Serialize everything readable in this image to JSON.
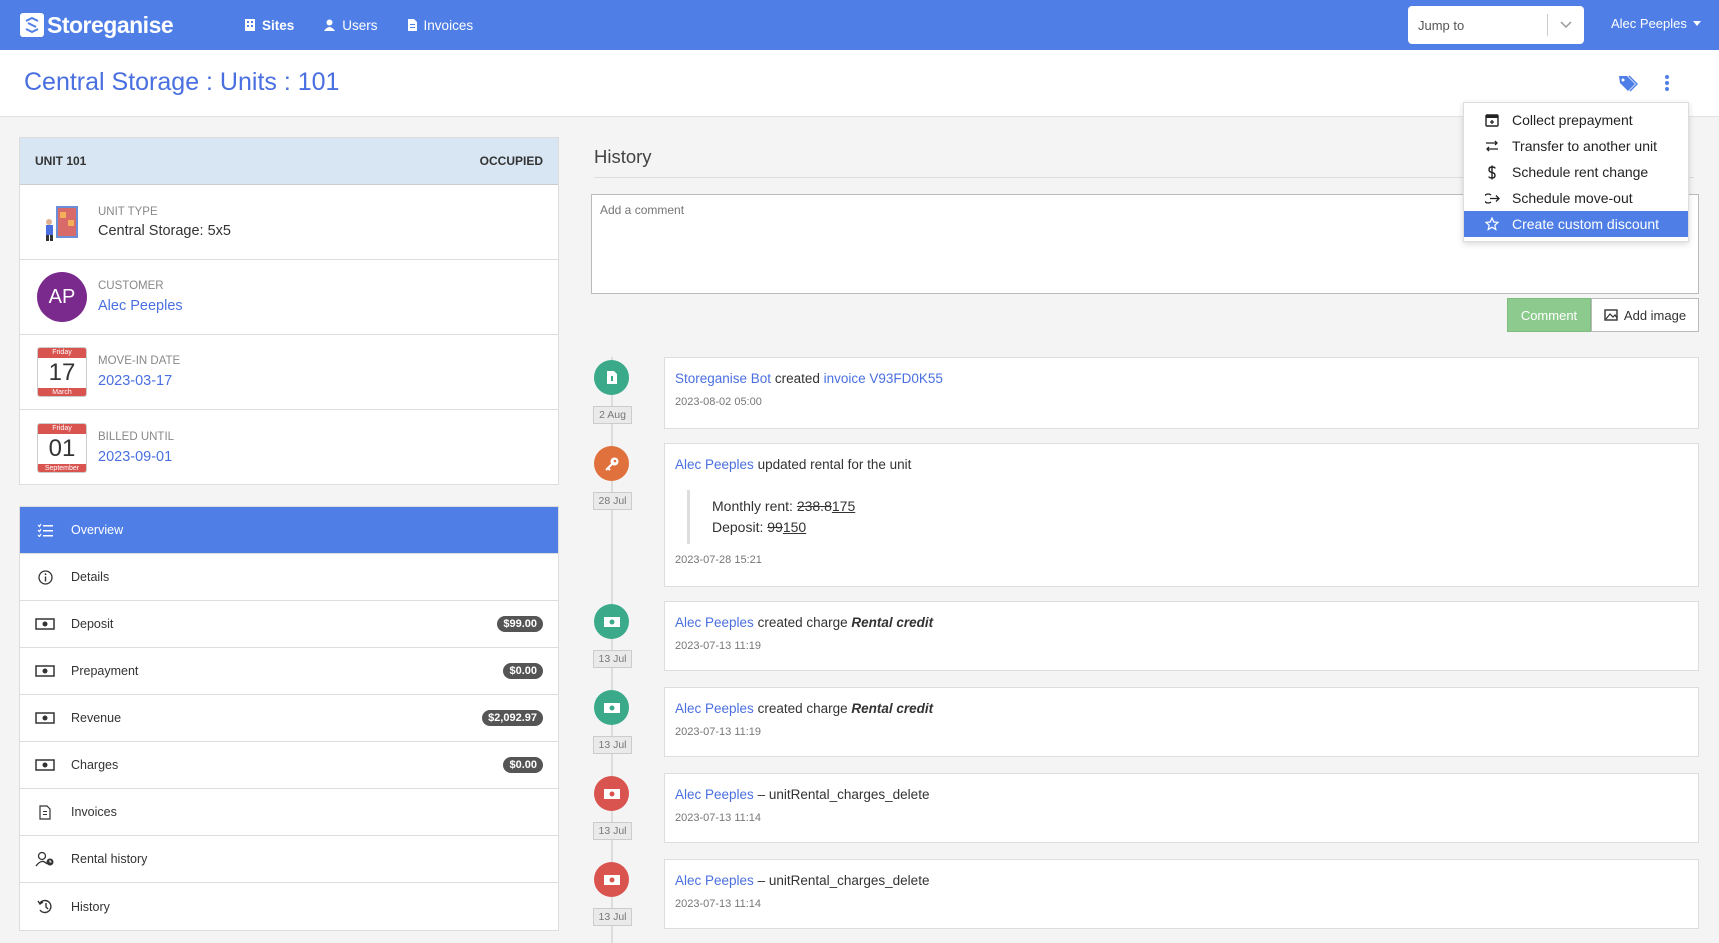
{
  "nav": {
    "brand": "Storeganise",
    "links": [
      {
        "label": "Sites",
        "icon": "building-icon"
      },
      {
        "label": "Users",
        "icon": "user-icon"
      },
      {
        "label": "Invoices",
        "icon": "invoice-icon"
      }
    ],
    "jump_placeholder": "Jump to",
    "user": "Alec Peeples"
  },
  "page": {
    "title": "Central Storage : Units : 101"
  },
  "unit": {
    "header_left": "UNIT 101",
    "header_right": "OCCUPIED",
    "type_label": "UNIT TYPE",
    "type_value": "Central Storage: 5x5",
    "customer_label": "CUSTOMER",
    "customer_initials": "AP",
    "customer_name": "Alec Peeples",
    "movein_label": "MOVE-IN DATE",
    "movein_value": "2023-03-17",
    "movein_cal": {
      "weekday": "Friday",
      "day": "17",
      "month": "March"
    },
    "billed_label": "BILLED UNTIL",
    "billed_value": "2023-09-01",
    "billed_cal": {
      "weekday": "Friday",
      "day": "01",
      "month": "September"
    }
  },
  "menu": [
    {
      "label": "Overview"
    },
    {
      "label": "Details"
    },
    {
      "label": "Deposit",
      "badge": "$99.00"
    },
    {
      "label": "Prepayment",
      "badge": "$0.00"
    },
    {
      "label": "Revenue",
      "badge": "$2,092.97"
    },
    {
      "label": "Charges",
      "badge": "$0.00"
    },
    {
      "label": "Invoices"
    },
    {
      "label": "Rental history"
    },
    {
      "label": "History"
    }
  ],
  "history": {
    "title": "History",
    "comment_placeholder": "Add a comment",
    "comment_button": "Comment",
    "add_image_button": "Add image",
    "entries": [
      {
        "date": "2 Aug",
        "actor": "Storeganise Bot",
        "action": "created",
        "link": "invoice V93FD0K55",
        "time": "2023-08-02 05:00"
      },
      {
        "date": "28 Jul",
        "actor": "Alec Peeples",
        "action": "updated rental for the unit",
        "rent_label": "Monthly rent:",
        "rent_old": "238.8",
        "rent_new": "175",
        "deposit_label": "Deposit:",
        "deposit_old": "99",
        "deposit_new": "150",
        "time": "2023-07-28 15:21"
      },
      {
        "date": "13 Jul",
        "actor": "Alec Peeples",
        "action": "created charge",
        "emph": "Rental credit",
        "time": "2023-07-13 11:19"
      },
      {
        "date": "13 Jul",
        "actor": "Alec Peeples",
        "action": "created charge",
        "emph": "Rental credit",
        "time": "2023-07-13 11:19"
      },
      {
        "date": "13 Jul",
        "actor": "Alec Peeples",
        "action": "– unitRental_charges_delete",
        "time": "2023-07-13 11:14"
      },
      {
        "date": "13 Jul",
        "actor": "Alec Peeples",
        "action": "– unitRental_charges_delete",
        "time": "2023-07-13 11:14"
      }
    ]
  },
  "dropdown": [
    {
      "label": "Collect prepayment",
      "icon": "calendar-plus-icon"
    },
    {
      "label": "Transfer to another unit",
      "icon": "transfer-icon"
    },
    {
      "label": "Schedule rent change",
      "icon": "dollar-icon"
    },
    {
      "label": "Schedule move-out",
      "icon": "move-out-icon"
    },
    {
      "label": "Create custom discount",
      "icon": "star-icon"
    }
  ],
  "colors": {
    "accent": "#4f7fe6",
    "green": "#3aaa8a",
    "orange": "#e0713d",
    "red": "#d9534f",
    "comment_btn": "#8dca8d"
  }
}
